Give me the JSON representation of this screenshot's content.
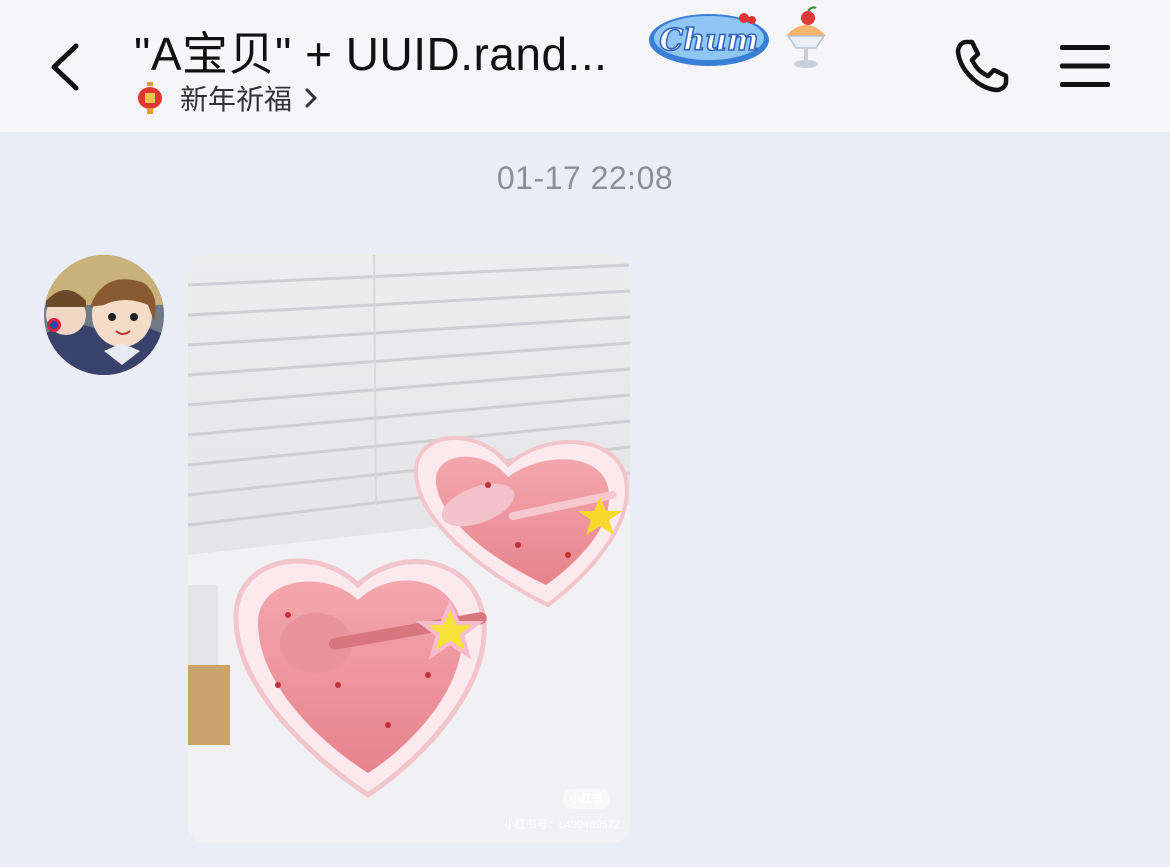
{
  "header": {
    "title": "\"A宝贝\" + UUID.rand...",
    "subtitle": "新年祈福",
    "icons": {
      "back": "chevron-left-icon",
      "title_badge": "chum-sticker-icon",
      "title_emoji": "shaved-ice-icon",
      "subtitle_icon": "red-lantern-icon",
      "subtitle_chevron": "chevron-right-icon",
      "call": "phone-icon",
      "menu": "hamburger-menu-icon"
    }
  },
  "chat": {
    "timestamp": "01-17 22:08",
    "message": {
      "type": "image",
      "sender_avatar": "avatar",
      "image_description_icons": "heart-bowl-photo",
      "watermark_brand": "小红书",
      "watermark_id": "小红书号：L499489572"
    }
  },
  "colors": {
    "header_bg": "#f6f6f8",
    "chat_bg": "#eaedf6",
    "timestamp_text": "#8d8f98",
    "title_text": "#111111"
  }
}
